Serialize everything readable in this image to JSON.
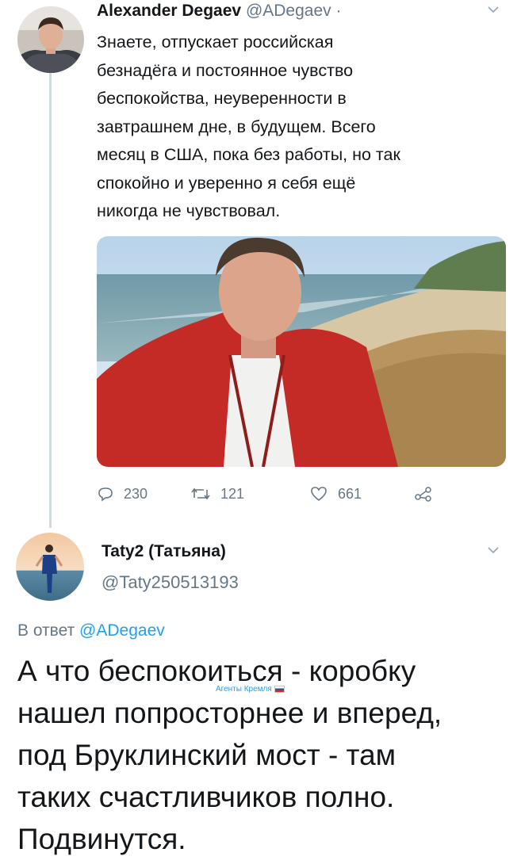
{
  "tweet": {
    "author_name": "Alexander Degaev",
    "author_handle": "@ADegaev",
    "separator": "·",
    "text_lines": [
      "Знаете, отпускает российская",
      "безнадёга и постоянное чувство",
      "беспокойства, неуверенности в",
      "завтрашнем дне, в будущем. Всего",
      "месяц в США, пока без работы, но так",
      "спокойно и уверенно я себя ещё",
      "никогда не чувствовал."
    ],
    "reply_count": "230",
    "retweet_count": "121",
    "like_count": "661",
    "icons": {
      "reply": "comment-icon",
      "retweet": "retweet-icon",
      "like": "heart-icon",
      "share": "share-icon",
      "menu": "chevron-down-icon"
    }
  },
  "reply": {
    "author_name": "Taty2 (Татьяна)",
    "author_handle": "@Taty250513193",
    "reply_prefix": "В ответ",
    "reply_to_handle": "@ADegaev",
    "text_lines": [
      "А что беспокоиться - коробку",
      "нашел попросторнее и вперед,",
      "под Бруклинский мост - там",
      "таких счастливчиков полно.",
      "Подвинутся."
    ]
  },
  "watermark": {
    "text": "Агенты Кремля"
  },
  "colors": {
    "text": "#14171a",
    "secondary": "#657786",
    "link": "#1da1f2",
    "thread_line": "#cfd9de"
  }
}
